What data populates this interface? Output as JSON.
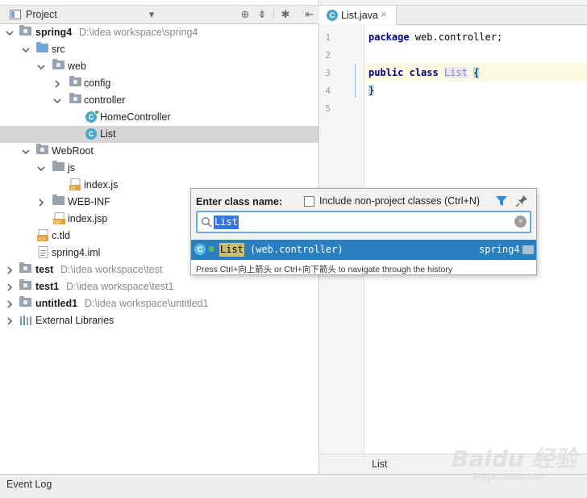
{
  "project_panel": {
    "header_title": "Project",
    "tree": [
      {
        "label": "spring4",
        "path": "D:\\idea workspace\\spring4"
      },
      {
        "label": "src"
      },
      {
        "label": "web"
      },
      {
        "label": "config"
      },
      {
        "label": "controller"
      },
      {
        "label": "HomeController"
      },
      {
        "label": "List"
      },
      {
        "label": "WebRoot"
      },
      {
        "label": "js"
      },
      {
        "label": "index.js"
      },
      {
        "label": "WEB-INF"
      },
      {
        "label": "index.jsp"
      },
      {
        "label": "c.tld"
      },
      {
        "label": "spring4.iml"
      },
      {
        "label": "test",
        "path": "D:\\idea workspace\\test"
      },
      {
        "label": "test1",
        "path": "D:\\idea workspace\\test1"
      },
      {
        "label": "untitled1",
        "path": "D:\\idea workspace\\untitled1"
      },
      {
        "label": "External Libraries"
      }
    ],
    "icon_badges": {
      "js": "JS",
      "jsp": "JSP",
      "tld": "<>",
      "class": "C"
    }
  },
  "editor": {
    "tab_label": "List.java",
    "tab_close": "×",
    "line_numbers": [
      "1",
      "2",
      "3",
      "4",
      "5"
    ],
    "lines": {
      "l1_kw": "package",
      "l1_rest": " web.controller;",
      "l3_kw1": "public",
      "l3_kw2": "class",
      "l3_name": "List",
      "l3_brace": "{",
      "l4_brace": "}"
    },
    "footer_text": "List"
  },
  "popup": {
    "label": "Enter class name:",
    "include_checkbox_label": "Include non-project classes (Ctrl+N)",
    "include_checked": false,
    "search_value": "List",
    "clear_glyph": "×",
    "result": {
      "name": "List",
      "package": "(web.controller)",
      "module": "spring4",
      "icon_letter": "C"
    },
    "hint": "Press Ctrl+向上箭头 or Ctrl+向下箭头 to navigate through the history"
  },
  "bottom_bar": {
    "event_log_label": "Event Log"
  },
  "watermark": {
    "big": "Baidu 经验",
    "small": "jingyan.baidu.com"
  },
  "colors": {
    "selection_blue": "#2a7fc1",
    "keyword_navy": "#000080",
    "class_badge": "#49a7c8",
    "source_folder": "#6fa7dc"
  }
}
